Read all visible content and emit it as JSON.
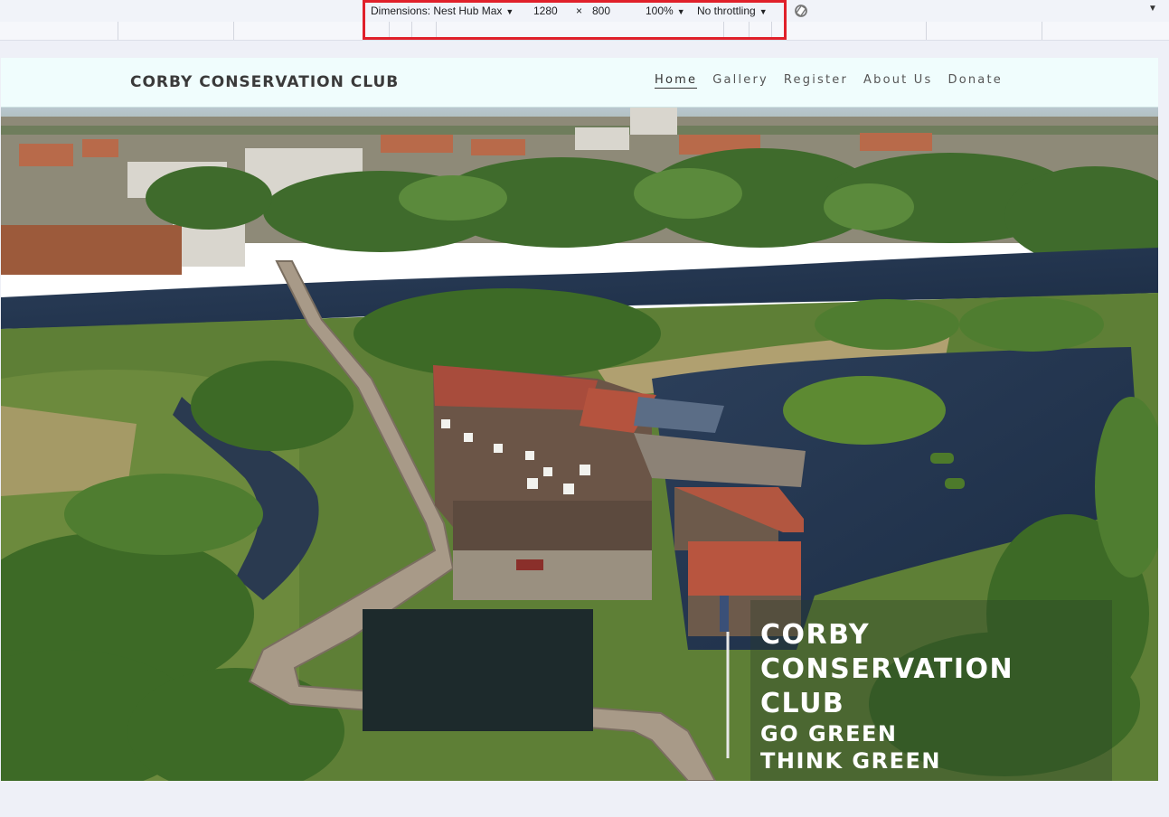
{
  "devtools": {
    "device": "Dimensions: Nest Hub Max",
    "width": "1280",
    "times": "×",
    "height": "800",
    "zoom": "100%",
    "throttling": "No throttling"
  },
  "site": {
    "brand": "CORBY CONSERVATION CLUB",
    "nav": [
      "Home",
      "Gallery",
      "Register",
      "About Us",
      "Donate"
    ],
    "hero_title": "CORBY CONSERVATION CLUB",
    "hero_line1": "GO GREEN",
    "hero_line2": "THINK GREEN"
  },
  "colors": {
    "nav_bg": "#f0fdfd",
    "accent_outline": "#e0202a",
    "hero_text": "#ffffff"
  }
}
